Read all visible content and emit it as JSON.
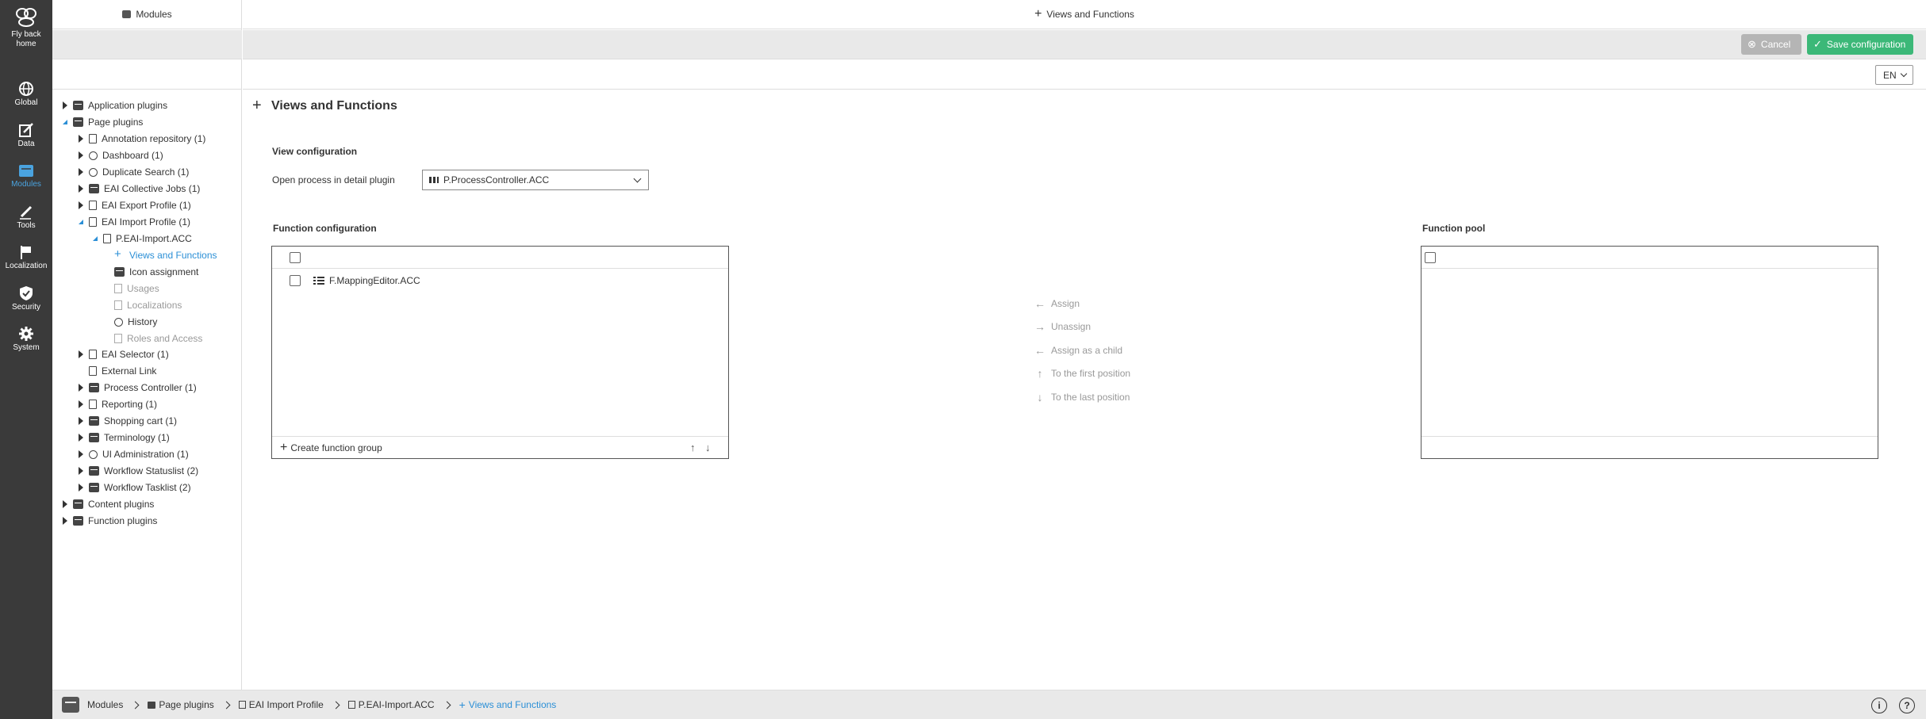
{
  "rail": {
    "items": [
      {
        "label": "Fly back\nhome",
        "icon": "bee-icon"
      },
      {
        "label": "Global",
        "icon": "globe-icon"
      },
      {
        "label": "Data",
        "icon": "edit-icon"
      },
      {
        "label": "Modules",
        "icon": "modules-icon",
        "active": true
      },
      {
        "label": "Tools",
        "icon": "pencil-icon"
      },
      {
        "label": "Localization",
        "icon": "flag-icon"
      },
      {
        "label": "Security",
        "icon": "shield-icon"
      },
      {
        "label": "System",
        "icon": "gear-icon"
      }
    ]
  },
  "tree": {
    "header": "Modules",
    "nodes": [
      {
        "label": "Application plugins"
      },
      {
        "label": "Page plugins"
      },
      {
        "label": "Annotation repository (1)"
      },
      {
        "label": "Dashboard (1)"
      },
      {
        "label": "Duplicate Search (1)"
      },
      {
        "label": "EAI Collective Jobs (1)"
      },
      {
        "label": "EAI Export Profile (1)"
      },
      {
        "label": "EAI Import Profile (1)"
      },
      {
        "label": "P.EAI-Import.ACC"
      },
      {
        "label": "Views and Functions"
      },
      {
        "label": "Icon assignment"
      },
      {
        "label": "Usages"
      },
      {
        "label": "Localizations"
      },
      {
        "label": "History"
      },
      {
        "label": "Roles and Access"
      },
      {
        "label": "EAI Selector (1)"
      },
      {
        "label": "External Link"
      },
      {
        "label": "Process Controller (1)"
      },
      {
        "label": "Reporting (1)"
      },
      {
        "label": "Shopping cart (1)"
      },
      {
        "label": "Terminology (1)"
      },
      {
        "label": "UI Administration (1)"
      },
      {
        "label": "Workflow Statuslist (2)"
      },
      {
        "label": "Workflow Tasklist (2)"
      },
      {
        "label": "Content plugins"
      },
      {
        "label": "Function plugins"
      }
    ]
  },
  "topbar": {
    "title": "Views and Functions"
  },
  "actions": {
    "cancel": "Cancel",
    "save": "Save configuration"
  },
  "lang": "EN",
  "main": {
    "title": "Views and Functions",
    "view_config_label": "View configuration",
    "open_process_label": "Open process in detail plugin",
    "open_process_value": "P.ProcessController.ACC",
    "function_config_label": "Function configuration",
    "function_pool_label": "Function pool",
    "function_items": [
      "F.MappingEditor.ACC"
    ],
    "create_group": "Create function group",
    "assign_actions": [
      "Assign",
      "Unassign",
      "Assign as a child",
      "To the first position",
      "To the last position"
    ]
  },
  "breadcrumb": [
    "Modules",
    "Page plugins",
    "EAI Import Profile",
    "P.EAI-Import.ACC",
    "Views and Functions"
  ],
  "colors": {
    "rail_bg": "#3a3a3a",
    "accent": "#2b8fd6",
    "save": "#3cb878",
    "cancel": "#b5b5b5"
  }
}
